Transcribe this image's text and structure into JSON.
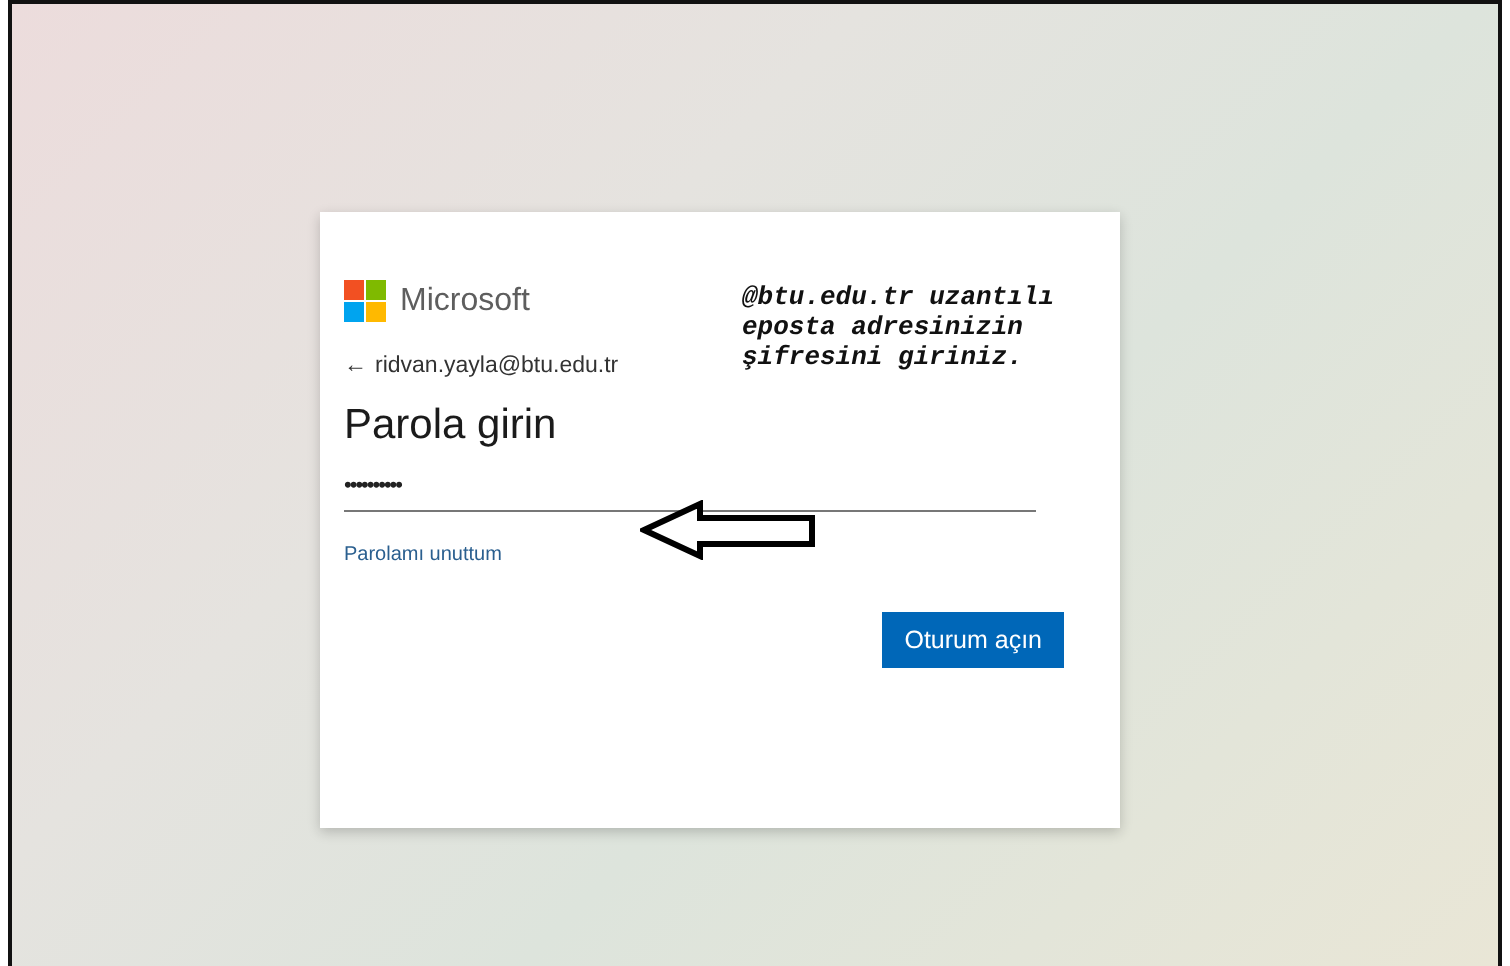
{
  "sign_in_card": {
    "brand": "Microsoft",
    "back_arrow": "←",
    "account": "ridvan.yayla@btu.edu.tr",
    "title": "Parola girin",
    "password": {
      "value": "••••••••••"
    },
    "forgot_link": "Parolamı unuttum",
    "submit_button": "Oturum açın"
  },
  "annotation": {
    "lines": [
      "@btu.edu.tr uzantılı",
      "eposta adresinizin",
      "şifresini giriniz."
    ]
  }
}
